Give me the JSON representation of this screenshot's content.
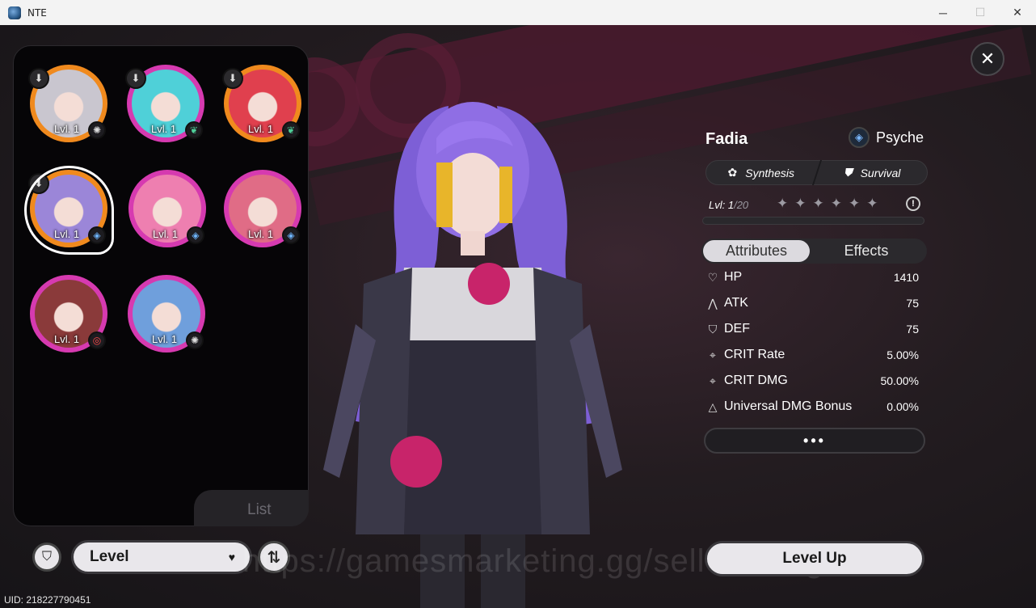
{
  "window": {
    "title": "NTE",
    "minimize": "─",
    "maximize": "☐",
    "close": "✕"
  },
  "roster": {
    "tab_label": "List",
    "characters": [
      {
        "level": "Lvl. 1",
        "element_icon": "gear-icon",
        "ring_color": "#f08a1e"
      },
      {
        "level": "Lvl. 1",
        "element_icon": "leaf-icon",
        "ring_color": "#d63ab0"
      },
      {
        "level": "Lvl. 1",
        "element_icon": "leaf-icon",
        "ring_color": "#f08a1e"
      },
      {
        "level": "Lvl. 1",
        "element_icon": "psyche-icon",
        "ring_color": "#f08a1e"
      },
      {
        "level": "Lvl. 1",
        "element_icon": "psyche-icon",
        "ring_color": "#d63ab0"
      },
      {
        "level": "Lvl. 1",
        "element_icon": "psyche-icon",
        "ring_color": "#d63ab0"
      },
      {
        "level": "Lvl. 1",
        "element_icon": "target-icon",
        "ring_color": "#d63ab0"
      },
      {
        "level": "Lvl. 1",
        "element_icon": "gear-icon",
        "ring_color": "#d63ab0"
      }
    ]
  },
  "controls": {
    "sort_label": "Level",
    "uid": "UID: 218227790451"
  },
  "character": {
    "name": "Fadia",
    "attribute": "Psyche",
    "role1": "Synthesis",
    "role2": "Survival",
    "level_prefix": "Lvl:",
    "level_current": "1",
    "level_max": "/20",
    "stars": "✦✦✦✦✦✦"
  },
  "tabs": {
    "attributes": "Attributes",
    "effects": "Effects"
  },
  "stats": [
    {
      "label": "HP",
      "value": "1410",
      "icon": "heart-icon"
    },
    {
      "label": "ATK",
      "value": "75",
      "icon": "atk-icon"
    },
    {
      "label": "DEF",
      "value": "75",
      "icon": "shield-icon"
    },
    {
      "label": "CRIT Rate",
      "value": "5.00%",
      "icon": "crosshair-icon"
    },
    {
      "label": "CRIT DMG",
      "value": "50.00%",
      "icon": "crosshair-icon"
    },
    {
      "label": "Universal DMG Bonus",
      "value": "0.00%",
      "icon": "triangle-icon"
    }
  ],
  "buttons": {
    "more": "•••",
    "level_up": "Level Up"
  },
  "watermark": "https://gamesmarketing.gg/seller/BangJohn"
}
